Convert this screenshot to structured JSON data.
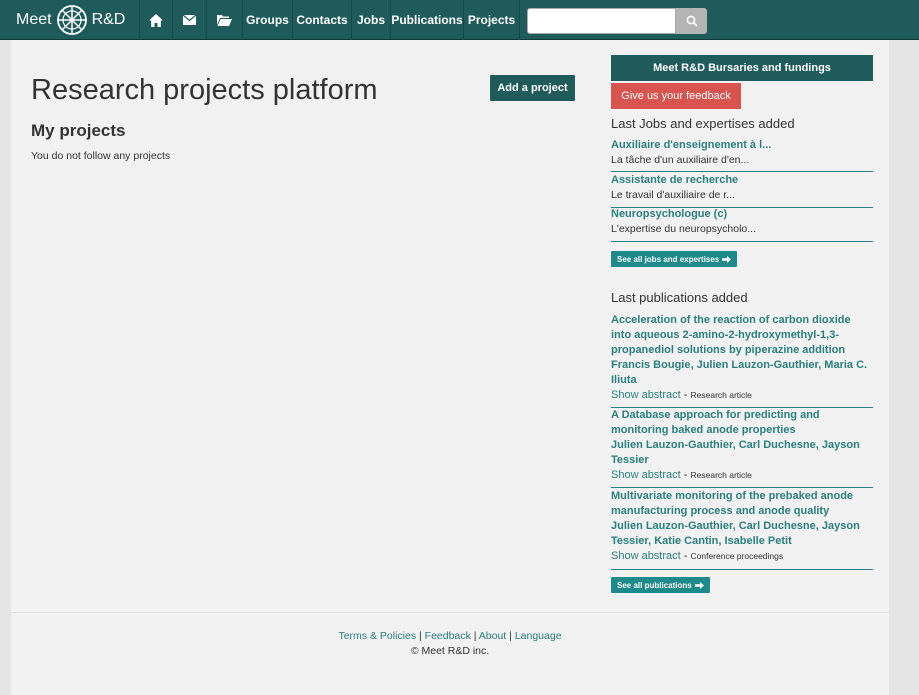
{
  "navbar": {
    "brand_left": "Meet",
    "brand_right": "R&D",
    "nav_groups": "Groups",
    "nav_contacts": "Contacts",
    "nav_jobs": "Jobs",
    "nav_publications": "Publications",
    "nav_projects": "Projects",
    "search_value": "",
    "icons": [
      "home-icon",
      "envelope-icon",
      "folder-open-icon",
      "search-icon"
    ]
  },
  "main": {
    "title": "Research projects platform",
    "add_project": "Add a project",
    "my_projects": "My projects",
    "empty_text": "You do not follow any projects"
  },
  "sidebar": {
    "bursaries": "Meet R&D Bursaries and fundings",
    "feedback": "Give us your feedback",
    "jobs_heading": "Last Jobs and expertises added",
    "jobs": [
      {
        "title": "Auxiliaire d'enseignement à l...",
        "desc": "La tâche d'un auxiliaire d'en..."
      },
      {
        "title": "Assistante de recherche",
        "desc": "Le travail d'auxiliaire de r..."
      },
      {
        "title": "Neuropsychologue (c)",
        "desc": "L'expertise du neuropsycholo..."
      }
    ],
    "see_all_jobs": "See all jobs and expertises",
    "pubs_heading": "Last publications added",
    "pubs": [
      {
        "title": "Acceleration of the reaction of carbon dioxide into aqueous 2-amino-2-hydroxymethyl-1,3-propanediol solutions by piperazine addition",
        "authors": "Francis Bougie, Julien Lauzon-Gauthier, Maria C. Iliuta",
        "show_abstract": "Show abstract",
        "type": "Research article"
      },
      {
        "title": "A Database approach for predicting and monitoring baked anode properties",
        "authors": "Julien Lauzon-Gauthier, Carl Duchesne, Jayson Tessier",
        "show_abstract": "Show abstract",
        "type": "Research article"
      },
      {
        "title": "Multivariate monitoring of the prebaked anode manufacturing process and anode quality",
        "authors": "Julien Lauzon-Gauthier, Carl Duchesne, Jayson Tessier, Katie Cantin, Isabelle Petit",
        "show_abstract": "Show abstract",
        "type": "Conference proceedings"
      }
    ],
    "see_all_pubs": "See all publications"
  },
  "footer": {
    "terms": "Terms & Policies",
    "feedback": "Feedback",
    "about": "About",
    "language": "Language",
    "sep": "|",
    "copyright": "© Meet R&D inc."
  },
  "colors": {
    "navbar": "#1f5b5b",
    "accent": "#2a7f7f",
    "feedback": "#d9534f",
    "button": "#1f8a8a"
  }
}
